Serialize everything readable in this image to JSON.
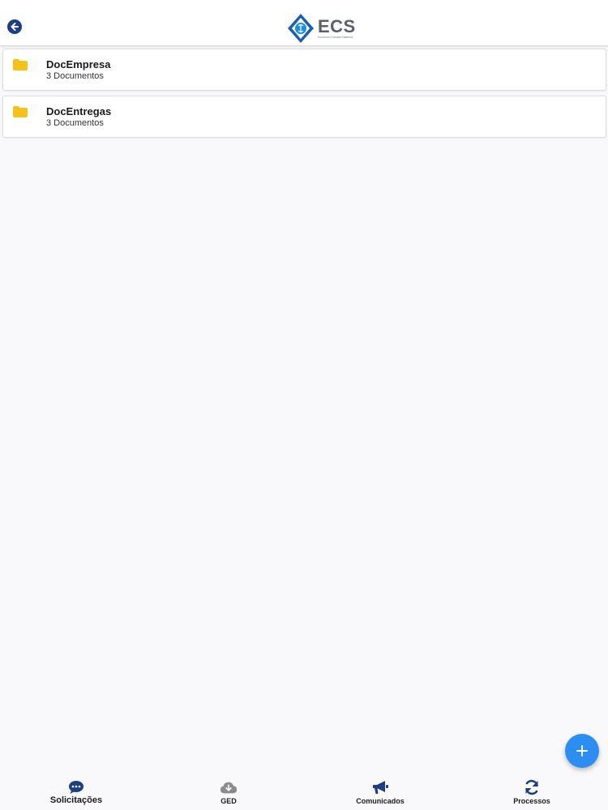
{
  "header": {
    "back_icon": "arrow-left-icon",
    "logo": {
      "title": "ECS",
      "subtitle": "Escritorio Contabil Sustenta"
    }
  },
  "folders": [
    {
      "name": "DocEmpresa",
      "count": "3 Documentos",
      "icon": "folder-icon"
    },
    {
      "name": "DocEntregas",
      "count": "3 Documentos",
      "icon": "folder-icon"
    }
  ],
  "fab": {
    "icon": "plus-icon"
  },
  "tabs": [
    {
      "label": "Solicitações",
      "icon": "chat-icon",
      "active": true
    },
    {
      "label": "GED",
      "icon": "cloud-download-icon",
      "active": false
    },
    {
      "label": "Comunicados",
      "icon": "megaphone-icon",
      "active": false
    },
    {
      "label": "Processos",
      "icon": "sync-icon",
      "active": false
    }
  ],
  "colors": {
    "primary": "#1d3e86",
    "accent": "#2c8ef0",
    "folder": "#f6c21a",
    "background": "#f9f9fb"
  }
}
